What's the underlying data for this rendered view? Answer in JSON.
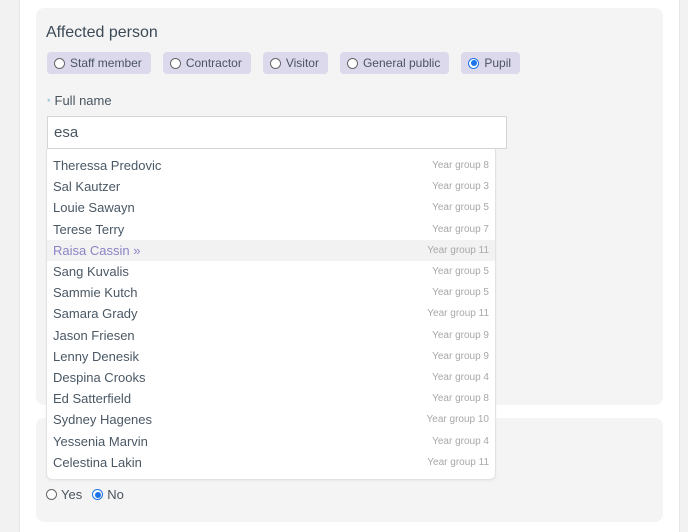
{
  "affected_person": {
    "title": "Affected person",
    "person_types": [
      {
        "label": "Staff member",
        "checked": false
      },
      {
        "label": "Contractor",
        "checked": false
      },
      {
        "label": "Visitor",
        "checked": false
      },
      {
        "label": "General public",
        "checked": false
      },
      {
        "label": "Pupil",
        "checked": true
      }
    ],
    "full_name": {
      "label": "Full name",
      "required_marker": "*",
      "value": "esa"
    },
    "suggestions": [
      {
        "name": "Theressa Predovic",
        "group": "Year group 8",
        "active": false
      },
      {
        "name": "Sal Kautzer",
        "group": "Year group 3",
        "active": false
      },
      {
        "name": "Louie Sawayn",
        "group": "Year group 5",
        "active": false
      },
      {
        "name": "Terese Terry",
        "group": "Year group 7",
        "active": false
      },
      {
        "name": "Raisa Cassin »",
        "group": "Year group 11",
        "active": true
      },
      {
        "name": "Sang Kuvalis",
        "group": "Year group 5",
        "active": false
      },
      {
        "name": "Sammie Kutch",
        "group": "Year group 5",
        "active": false
      },
      {
        "name": "Samara Grady",
        "group": "Year group 11",
        "active": false
      },
      {
        "name": "Jason Friesen",
        "group": "Year group 9",
        "active": false
      },
      {
        "name": "Lenny Denesik",
        "group": "Year group 9",
        "active": false
      },
      {
        "name": "Despina Crooks",
        "group": "Year group 4",
        "active": false
      },
      {
        "name": "Ed Satterfield",
        "group": "Year group 8",
        "active": false
      },
      {
        "name": "Sydney Hagenes",
        "group": "Year group 10",
        "active": false
      },
      {
        "name": "Yessenia Marvin",
        "group": "Year group 4",
        "active": false
      },
      {
        "name": "Celestina Lakin",
        "group": "Year group 11",
        "active": false
      }
    ]
  },
  "second_section": {
    "yes_label": "Yes",
    "no_label": "No",
    "selected": "No"
  },
  "colors": {
    "chip_bg": "#dcd9ec",
    "radio_accent": "#1a73e8",
    "active_option_text": "#8b84c4"
  }
}
